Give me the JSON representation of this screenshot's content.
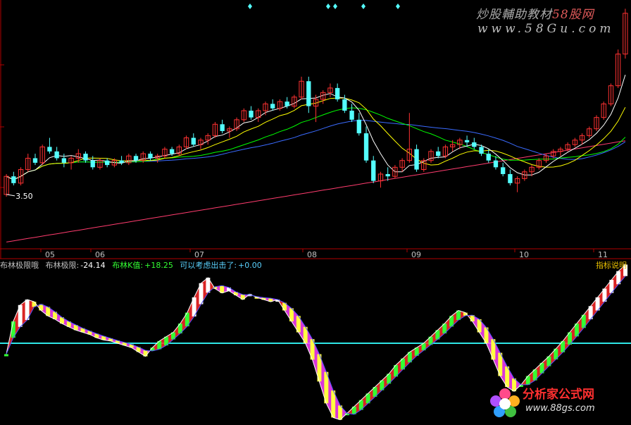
{
  "watermark": {
    "line1_prefix": "炒股輔助教材",
    "line1_highlight": "58股网",
    "line2": "www.58Gu.com"
  },
  "price_panel": {
    "low_marker": "3.50",
    "x_labels": [
      "05",
      "06",
      "07",
      "08",
      "09",
      "10",
      "11"
    ]
  },
  "indicator_bar": {
    "name": "布林极限哦",
    "item1_label": "布林极限:",
    "item1_value": "-24.14",
    "item2_label": "布林K值:",
    "item2_value": "+18.25",
    "item3_label": "可以考虑出击了:",
    "item3_value": "+0.00",
    "help": "指标说明"
  },
  "logo": {
    "title": "分析家公式网",
    "url": "www.88gs.com"
  },
  "colors": {
    "bg": "#000000",
    "up": "#ff3232",
    "down": "#54ffff",
    "ma5": "#ffffff",
    "ma10": "#ffff00",
    "ma20": "#ff00ff",
    "ma30": "#00ff00",
    "ma60": "#3a6bff",
    "ma120": "#ff3c6e",
    "axis": "#b00000",
    "zero_line": "#2ee6e6",
    "ind_white": "#ffffff",
    "ind_yellow": "#ffff40",
    "ind_magenta": "#ff40ff",
    "ind_green": "#33ff33",
    "ind_red": "#ff2a2a",
    "ind_blue": "#5050ff",
    "text_label": "#c0c0c0",
    "text_value": "#ffffff",
    "text_k": "#33ff33",
    "text_ex": "#5ad2ff"
  },
  "chart_data": [
    {
      "type": "candlestick",
      "x_labels": [
        "05",
        "06",
        "07",
        "08",
        "09",
        "10",
        "11"
      ],
      "annotations": [
        "3.50"
      ],
      "series": [
        {
          "values": [
            [
              3.5,
              3.95,
              3.45,
              3.9
            ],
            [
              3.9,
              4.0,
              3.7,
              3.75
            ],
            [
              3.75,
              4.1,
              3.7,
              4.05
            ],
            [
              4.05,
              4.4,
              4.0,
              4.3
            ],
            [
              4.3,
              4.4,
              4.15,
              4.2
            ],
            [
              4.2,
              4.6,
              4.15,
              4.55
            ],
            [
              4.55,
              4.75,
              4.4,
              4.45
            ],
            [
              4.45,
              4.55,
              4.25,
              4.3
            ],
            [
              4.3,
              4.4,
              4.1,
              4.2
            ],
            [
              4.2,
              4.35,
              4.05,
              4.3
            ],
            [
              4.3,
              4.5,
              4.2,
              4.4
            ],
            [
              4.4,
              4.45,
              4.2,
              4.25
            ],
            [
              4.25,
              4.35,
              4.05,
              4.1
            ],
            [
              4.1,
              4.3,
              4.05,
              4.25
            ],
            [
              4.25,
              4.3,
              4.1,
              4.15
            ],
            [
              4.15,
              4.3,
              4.1,
              4.25
            ],
            [
              4.25,
              4.35,
              4.15,
              4.2
            ],
            [
              4.2,
              4.4,
              4.15,
              4.35
            ],
            [
              4.35,
              4.4,
              4.2,
              4.25
            ],
            [
              4.25,
              4.45,
              4.2,
              4.4
            ],
            [
              4.4,
              4.45,
              4.25,
              4.3
            ],
            [
              4.3,
              4.4,
              4.2,
              4.35
            ],
            [
              4.35,
              4.55,
              4.3,
              4.5
            ],
            [
              4.5,
              4.55,
              4.35,
              4.4
            ],
            [
              4.4,
              4.6,
              4.35,
              4.55
            ],
            [
              4.55,
              4.8,
              4.5,
              4.75
            ],
            [
              4.75,
              4.85,
              4.55,
              4.6
            ],
            [
              4.6,
              4.75,
              4.5,
              4.7
            ],
            [
              4.7,
              4.85,
              4.6,
              4.8
            ],
            [
              4.8,
              5.1,
              4.75,
              5.05
            ],
            [
              5.05,
              5.15,
              4.85,
              4.9
            ],
            [
              4.9,
              5.0,
              4.75,
              4.95
            ],
            [
              4.95,
              5.2,
              4.9,
              5.15
            ],
            [
              5.15,
              5.4,
              5.1,
              5.35
            ],
            [
              5.35,
              5.45,
              5.15,
              5.2
            ],
            [
              5.2,
              5.4,
              5.1,
              5.35
            ],
            [
              5.35,
              5.55,
              5.25,
              5.5
            ],
            [
              5.5,
              5.6,
              5.35,
              5.4
            ],
            [
              5.4,
              5.6,
              5.35,
              5.55
            ],
            [
              5.55,
              5.65,
              5.4,
              5.45
            ],
            [
              5.45,
              5.7,
              5.4,
              5.65
            ],
            [
              5.65,
              6.1,
              5.6,
              6.0
            ],
            [
              6.0,
              6.1,
              5.3,
              5.45
            ],
            [
              5.45,
              5.7,
              5.1,
              5.6
            ],
            [
              5.6,
              5.8,
              5.5,
              5.75
            ],
            [
              5.75,
              5.95,
              5.65,
              5.85
            ],
            [
              5.85,
              5.95,
              5.55,
              5.6
            ],
            [
              5.6,
              5.7,
              5.3,
              5.35
            ],
            [
              5.35,
              5.5,
              5.1,
              5.15
            ],
            [
              5.15,
              5.3,
              4.8,
              4.85
            ],
            [
              4.85,
              5.0,
              4.2,
              4.25
            ],
            [
              4.25,
              4.35,
              3.75,
              3.8
            ],
            [
              3.8,
              4.0,
              3.65,
              3.95
            ],
            [
              3.95,
              4.1,
              3.8,
              3.9
            ],
            [
              3.9,
              4.15,
              3.85,
              4.1
            ],
            [
              4.1,
              4.3,
              4.0,
              4.25
            ],
            [
              4.25,
              5.3,
              4.2,
              4.5
            ],
            [
              4.5,
              4.6,
              4.0,
              4.05
            ],
            [
              4.05,
              4.3,
              4.0,
              4.25
            ],
            [
              4.25,
              4.5,
              4.2,
              4.45
            ],
            [
              4.45,
              4.55,
              4.3,
              4.35
            ],
            [
              4.35,
              4.6,
              4.3,
              4.55
            ],
            [
              4.55,
              4.7,
              4.45,
              4.6
            ],
            [
              4.6,
              4.75,
              4.5,
              4.7
            ],
            [
              4.7,
              4.8,
              4.55,
              4.65
            ],
            [
              4.65,
              4.75,
              4.5,
              4.55
            ],
            [
              4.55,
              4.6,
              4.35,
              4.4
            ],
            [
              4.4,
              4.5,
              4.2,
              4.25
            ],
            [
              4.25,
              4.35,
              4.05,
              4.1
            ],
            [
              4.1,
              4.2,
              3.9,
              3.95
            ],
            [
              3.95,
              4.05,
              3.7,
              3.75
            ],
            [
              3.75,
              3.9,
              3.55,
              3.85
            ],
            [
              3.85,
              4.05,
              3.8,
              4.0
            ],
            [
              4.0,
              4.15,
              3.9,
              4.1
            ],
            [
              4.1,
              4.3,
              4.05,
              4.25
            ],
            [
              4.25,
              4.4,
              4.2,
              4.35
            ],
            [
              4.35,
              4.5,
              4.3,
              4.45
            ],
            [
              4.45,
              4.55,
              4.35,
              4.5
            ],
            [
              4.5,
              4.65,
              4.45,
              4.6
            ],
            [
              4.6,
              4.75,
              4.55,
              4.7
            ],
            [
              4.7,
              4.85,
              4.6,
              4.8
            ],
            [
              4.8,
              5.0,
              4.75,
              4.95
            ],
            [
              4.95,
              5.25,
              4.9,
              5.2
            ],
            [
              5.2,
              5.55,
              5.15,
              5.5
            ],
            [
              5.5,
              5.95,
              5.45,
              5.9
            ],
            [
              5.9,
              6.7,
              5.85,
              6.6
            ],
            [
              6.6,
              7.6,
              6.5,
              7.5
            ]
          ]
        }
      ],
      "moving_averages": [
        "MA5",
        "MA10",
        "MA20",
        "MA30",
        "MA60",
        "MA120"
      ]
    },
    {
      "type": "bar",
      "title": "布林极限哦",
      "series": [
        {
          "name": "布林极限",
          "value": -24.14
        },
        {
          "name": "布林K值",
          "value": 18.25
        },
        {
          "name": "可以考虑出击了",
          "value": 0.0
        }
      ],
      "oscillator_values": [
        -10,
        20,
        35,
        40,
        38,
        30,
        25,
        22,
        18,
        15,
        12,
        10,
        8,
        5,
        3,
        2,
        0,
        -2,
        -4,
        -8,
        -12,
        -4,
        2,
        6,
        10,
        18,
        28,
        42,
        55,
        60,
        50,
        46,
        48,
        44,
        40,
        45,
        42,
        40,
        38,
        40,
        30,
        20,
        10,
        0,
        -15,
        -35,
        -55,
        -68,
        -70,
        -64,
        -58,
        -52,
        -46,
        -40,
        -34,
        -28,
        -20,
        -14,
        -8,
        -4,
        0,
        6,
        12,
        18,
        25,
        30,
        28,
        20,
        10,
        0,
        -15,
        -30,
        -40,
        -44,
        -38,
        -30,
        -24,
        -18,
        -12,
        -5,
        2,
        10,
        18,
        26,
        34,
        42,
        50,
        58,
        66,
        72
      ],
      "zero_reference": 0
    }
  ]
}
